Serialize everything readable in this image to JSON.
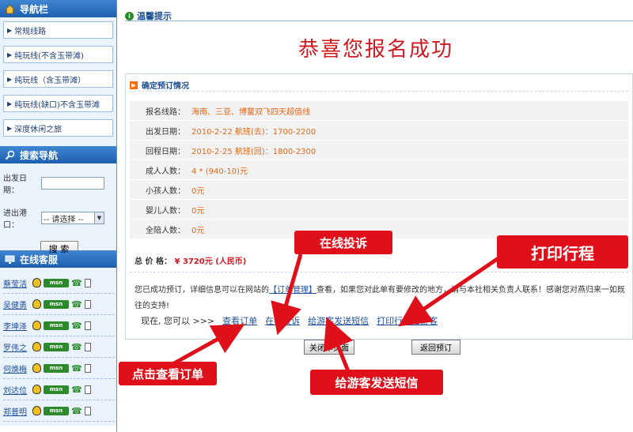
{
  "sidebar": {
    "nav_title": "导航栏",
    "nav_items": [
      "常规线路",
      "纯玩线(不含玉带滩)",
      "纯玩线（含玉带滩）",
      "纯玩线(缺口)不含玉带滩",
      "深度休闲之旅"
    ],
    "search_title": "搜索导航",
    "depart_label": "出发日期：",
    "depart_value": "",
    "port_label": "进出港口：",
    "port_selected": "-- 请选择 --",
    "search_button": "搜 索",
    "cs_title": "在线客服",
    "cs_names": [
      "蔡莹洁",
      "吴健勇",
      "李坤泽",
      "罗伟之",
      "何焕梅",
      "刘达位",
      "郑普明"
    ],
    "msn_label": "msn"
  },
  "main": {
    "tip_title": "温馨提示",
    "headline": "恭喜您报名成功",
    "box_title": "确定预订情况",
    "rows": [
      {
        "k": "报名线路：",
        "v": "海南、三亚、博鳌双飞四天超值线"
      },
      {
        "k": "出发日期：",
        "v": "2010-2-22 航班(去)：1700-2200"
      },
      {
        "k": "回程日期：",
        "v": "2010-2-25 航班(回)：1800-2300"
      },
      {
        "k": "成人人数：",
        "v": "4 * (940-10)元"
      },
      {
        "k": "小孩人数：",
        "v": "0元"
      },
      {
        "k": "婴儿人数：",
        "v": "0元"
      },
      {
        "k": "全陪人数：",
        "v": "0元"
      }
    ],
    "total_label": "总 价 格：",
    "total_amount": "¥ 3720元 (人民币)",
    "msg_part1": "您已成功预订，详细信息可以在网站的",
    "msg_link": "【订单管理】",
    "msg_part2": "查看，如果您对此单有要修改的地方，请与本社相关负责人联系！感谢您对燕归来一如既往的支持!",
    "actions_lead": "现在, 您可以 >>>",
    "actions": [
      "查看订单",
      "在线投诉",
      "给游客发送短信",
      "打印行程给游客"
    ],
    "close_button": "关闭本页面",
    "back_button": "返回预订"
  },
  "callouts": {
    "complaint": "在线投诉",
    "print": "打印行程",
    "view_order": "点击查看订单",
    "sms": "给游客发送短信"
  },
  "colors": {
    "accent_red": "#e0101a",
    "header_blue": "#1d5fae",
    "value_orange": "#e0681c"
  }
}
